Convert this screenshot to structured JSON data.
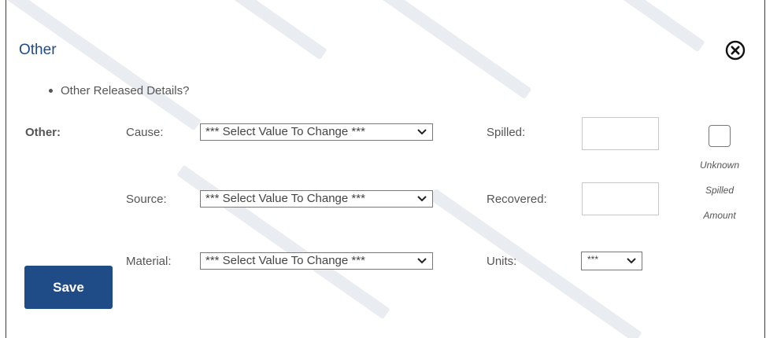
{
  "dialog": {
    "title": "Other",
    "close_icon": "close-circle-icon"
  },
  "question": "Other Released Details?",
  "section_label": "Other:",
  "fields": {
    "cause": {
      "label": "Cause:",
      "value": "*** Select Value To Change ***"
    },
    "source": {
      "label": "Source:",
      "value": "*** Select Value To Change ***"
    },
    "material": {
      "label": "Material:",
      "value": "*** Select Value To Change ***"
    },
    "spilled": {
      "label": "Spilled:",
      "value": ""
    },
    "recovered": {
      "label": "Recovered:",
      "value": ""
    },
    "units": {
      "label": "Units:",
      "value": "***"
    }
  },
  "unknown_spilled": {
    "line1": "Unknown",
    "line2": "Spilled",
    "line3": "Amount",
    "checked": false
  },
  "save_label": "Save",
  "colors": {
    "accent": "#1f4b87",
    "border": "#1f3f73",
    "text": "#555555"
  }
}
